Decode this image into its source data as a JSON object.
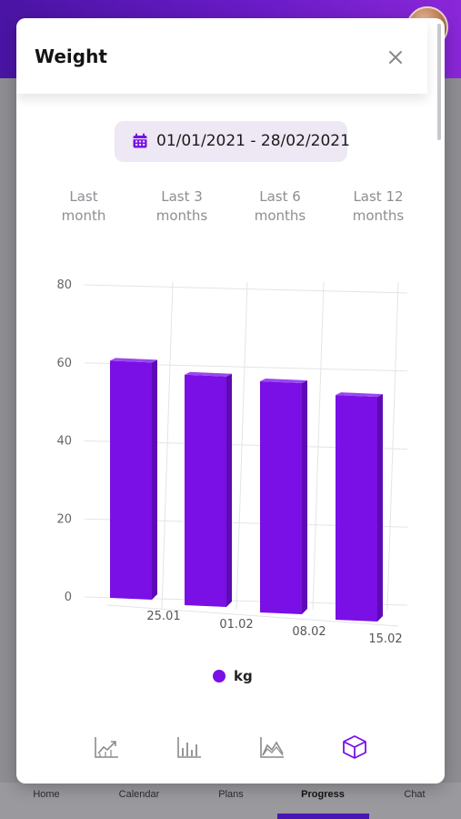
{
  "modal": {
    "title": "Weight",
    "date_range": "01/01/2021 - 28/02/2021",
    "range_tabs": [
      {
        "line1": "Last",
        "line2": "month"
      },
      {
        "line1": "Last 3",
        "line2": "months"
      },
      {
        "line1": "Last 6",
        "line2": "months"
      },
      {
        "line1": "Last 12",
        "line2": "months"
      }
    ],
    "chart_type_buttons": [
      "line-chart-icon",
      "bar-chart-icon",
      "area-chart-icon",
      "3d-cube-icon"
    ],
    "active_chart_type": "3d-cube-icon"
  },
  "chart_data": {
    "type": "bar",
    "categories": [
      "25.01",
      "01.02",
      "08.02",
      "15.02"
    ],
    "series": [
      {
        "name": "kg",
        "values": [
          65,
          62,
          61,
          58
        ]
      }
    ],
    "ylim": [
      0,
      80
    ],
    "yticks": [
      0,
      20,
      40,
      60,
      80
    ],
    "grid": true,
    "legend": "bottom-center",
    "bar_color": "#7a0fe6",
    "three_d": true
  },
  "bottom_nav": {
    "items": [
      "Home",
      "Calendar",
      "Plans",
      "Progress",
      "Chat"
    ],
    "active": "Progress"
  },
  "colors": {
    "accent": "#7a0fe6",
    "header_gradient_start": "#4a14a4",
    "header_gradient_end": "#8a27d8"
  }
}
